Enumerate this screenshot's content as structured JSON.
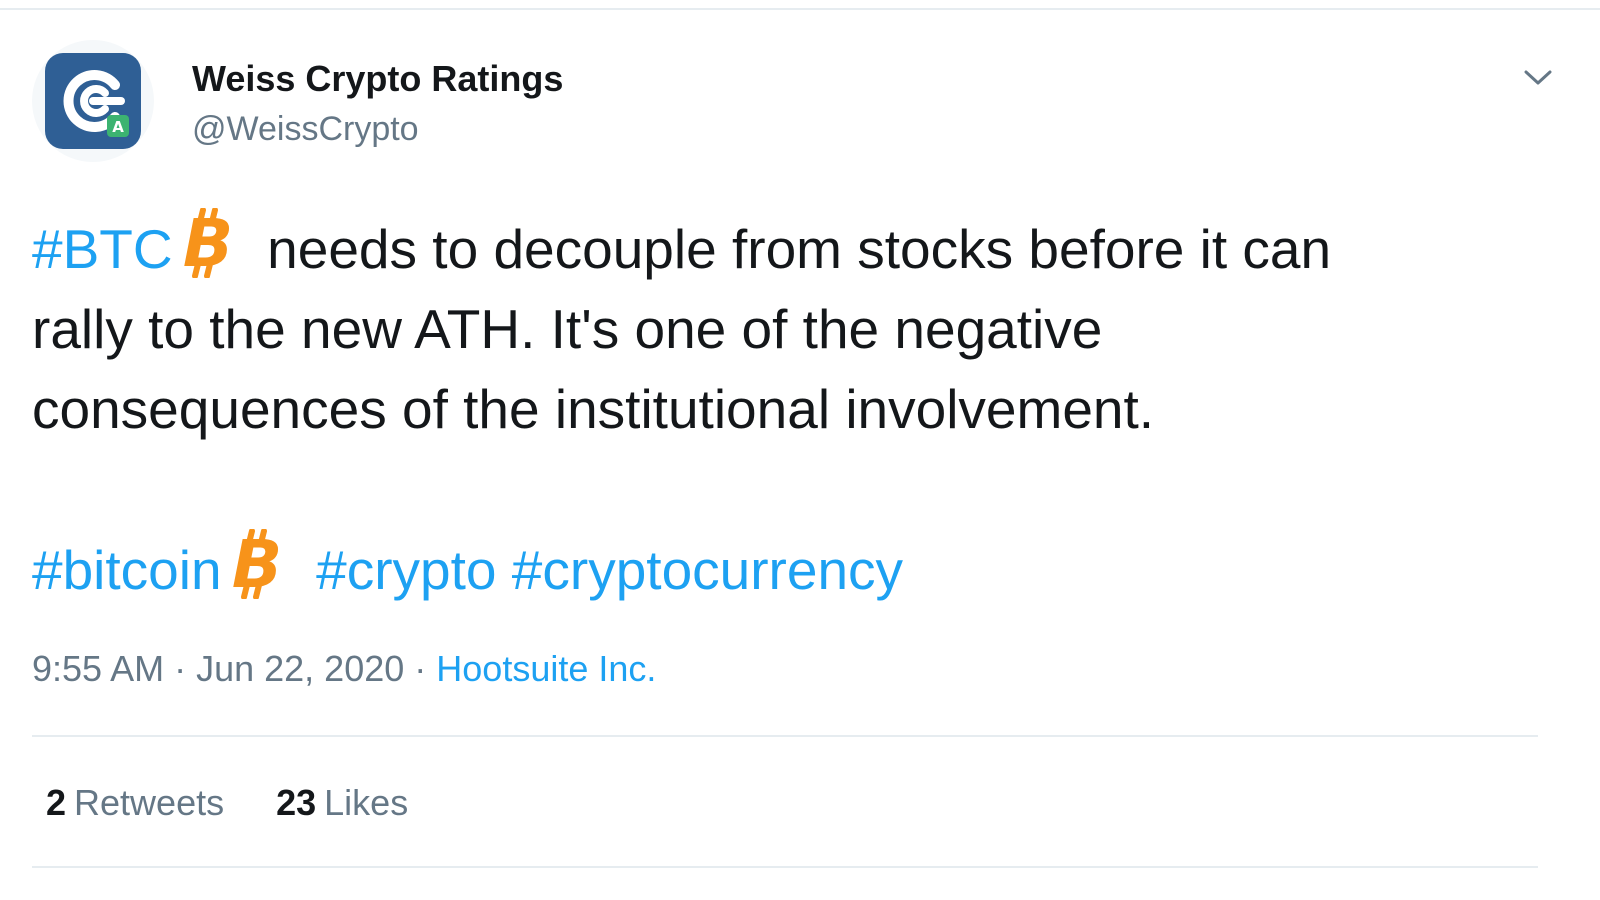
{
  "account": {
    "display_name": "Weiss Crypto Ratings",
    "handle": "@WeissCrypto",
    "avatar_icon": "weiss-crypto-logo-icon",
    "avatar_badge": "A"
  },
  "tweet": {
    "line1_hashtag": "#BTC",
    "line1_text": "needs to decouple from stocks before it can",
    "line2_text": "rally to the new ATH. It's one of the negative",
    "line3_text": "consequences of the institutional involvement.",
    "hashtags": [
      "#bitcoin",
      "#crypto",
      "#cryptocurrency"
    ],
    "emoji_icon": "bitcoin-emoji-icon"
  },
  "meta": {
    "time": "9:55 AM",
    "separator": " · ",
    "date": "Jun 22, 2020",
    "source": "Hootsuite Inc."
  },
  "stats": {
    "retweets_count": "2",
    "retweets_label": "Retweets",
    "likes_count": "23",
    "likes_label": "Likes"
  },
  "colors": {
    "link": "#1da1f2",
    "text": "#14171a",
    "muted": "#657786",
    "bitcoin_orange": "#f7931a",
    "avatar_blue": "#2f5f95"
  }
}
